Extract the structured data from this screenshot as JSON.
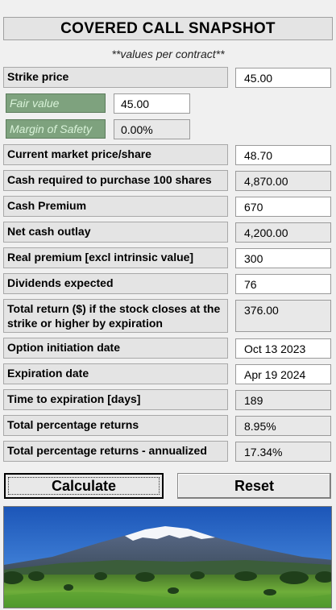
{
  "title": "COVERED CALL SNAPSHOT",
  "subtitle": "**values per contract**",
  "strike": {
    "label": "Strike price",
    "value": "45.00"
  },
  "fair_value": {
    "label": "Fair value",
    "value": "45.00"
  },
  "margin_of_safety": {
    "label": "Margin of Safety",
    "value": "0.00%"
  },
  "rows": [
    {
      "label": "Current market price/share",
      "value": "48.70"
    },
    {
      "label": "Cash required to purchase 100 shares",
      "value": "4,870.00"
    },
    {
      "label": "Cash Premium",
      "value": "670"
    },
    {
      "label": "Net cash outlay",
      "value": "4,200.00"
    },
    {
      "label": "Real premium [excl intrinsic value]",
      "value": "300"
    },
    {
      "label": "Dividends expected",
      "value": "76"
    },
    {
      "label": "Total return ($) if the stock closes at the strike or higher by expiration",
      "value": "376.00"
    },
    {
      "label": "Option initiation date",
      "value": "Oct 13 2023"
    },
    {
      "label": "Expiration date",
      "value": "Apr 19 2024"
    },
    {
      "label": "Time to expiration [days]",
      "value": "189"
    },
    {
      "label": "Total percentage returns",
      "value": "8.95%"
    },
    {
      "label": "Total percentage returns - annualized",
      "value": "17.34%"
    }
  ],
  "buttons": {
    "calculate": "Calculate",
    "reset": "Reset"
  },
  "image": {
    "description_icon": "mountain-landscape-image"
  }
}
